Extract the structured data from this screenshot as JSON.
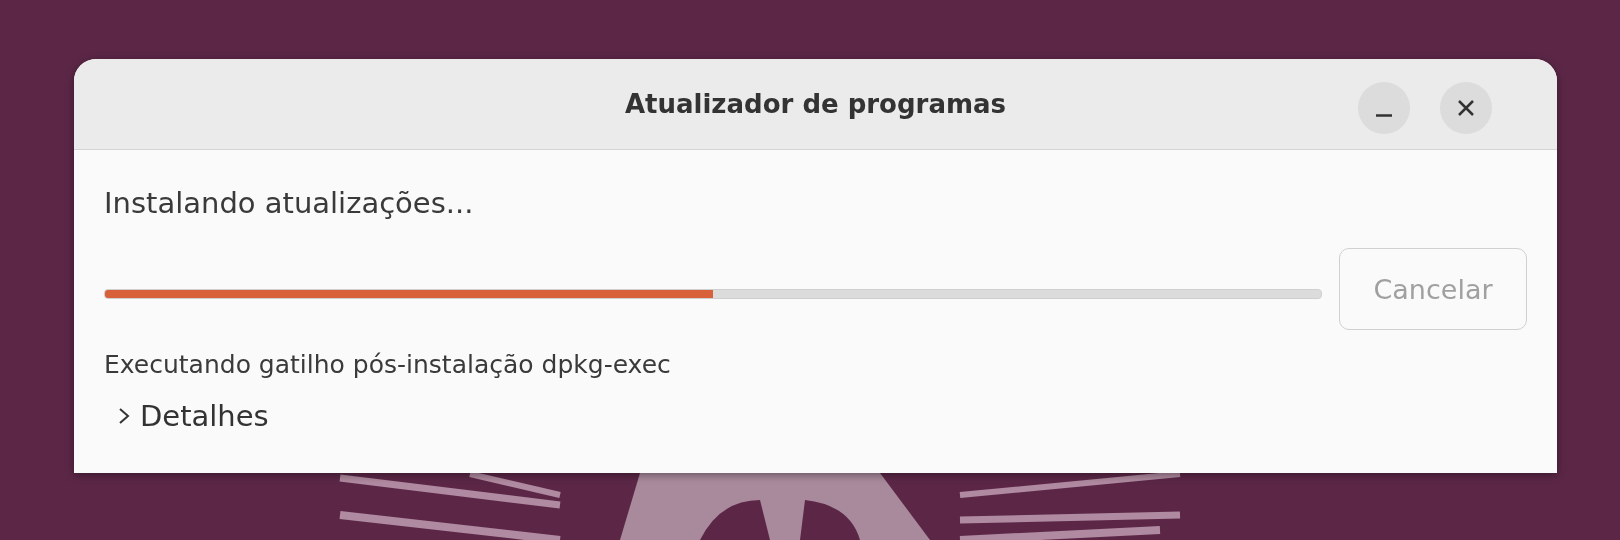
{
  "window": {
    "title": "Atualizador de programas"
  },
  "title_buttons": [
    {
      "kind": "minimize"
    },
    {
      "kind": "close"
    }
  ],
  "status": "Instalando atualizações...",
  "progress": {
    "level": 0.5
  },
  "cancel_button": {
    "label": "Cancelar",
    "disabled": true
  },
  "detail_text": "Executando gatilho pós-instalação dpkg-exec",
  "details": {
    "label": "Detalhes",
    "expanded": false
  }
}
